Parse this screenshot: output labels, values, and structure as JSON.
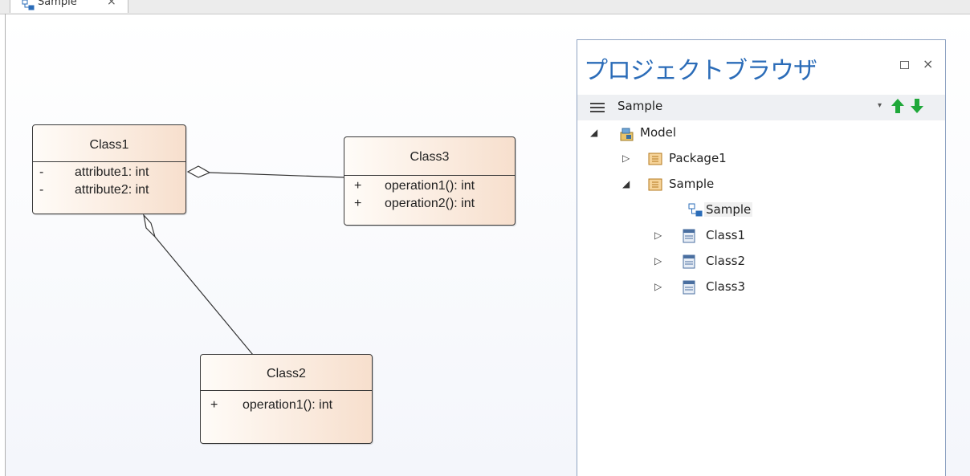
{
  "tab": {
    "label": "Sample",
    "close_glyph": "×",
    "icon": "diagram-icon"
  },
  "diagram": {
    "classes": [
      {
        "name": "Class1",
        "members": [
          {
            "visibility": "-",
            "signature": "attribute1: int"
          },
          {
            "visibility": "-",
            "signature": "attribute2: int"
          }
        ]
      },
      {
        "name": "Class3",
        "members": [
          {
            "visibility": "+",
            "signature": "operation1(): int"
          },
          {
            "visibility": "+",
            "signature": "operation2(): int"
          }
        ]
      },
      {
        "name": "Class2",
        "members": [
          {
            "visibility": "+",
            "signature": "operation1(): int"
          }
        ]
      }
    ],
    "relations": [
      {
        "type": "aggregation",
        "whole": "Class1",
        "part": "Class3"
      },
      {
        "type": "aggregation",
        "whole": "Class1",
        "part": "Class2"
      }
    ]
  },
  "browser": {
    "title": "プロジェクトブラウザ",
    "maximize_icon": "maximize-icon",
    "close_glyph": "×",
    "toolbar": {
      "menu_icon": "hamburger-icon",
      "current": "Sample",
      "dropdown_glyph": "▾",
      "move_up_icon": "arrow-up-icon",
      "move_down_icon": "arrow-down-icon"
    },
    "tree": [
      {
        "label": "Model",
        "icon": "model-root-icon",
        "expander": "◢"
      },
      {
        "label": "Package1",
        "icon": "package-icon",
        "expander": "▷"
      },
      {
        "label": "Sample",
        "icon": "package-icon",
        "expander": "◢"
      },
      {
        "label": "Sample",
        "icon": "diagram-icon",
        "expander": ""
      },
      {
        "label": "Class1",
        "icon": "class-icon",
        "expander": "▷"
      },
      {
        "label": "Class2",
        "icon": "class-icon",
        "expander": "▷"
      },
      {
        "label": "Class3",
        "icon": "class-icon",
        "expander": "▷"
      }
    ]
  },
  "colors": {
    "title_blue": "#2b6cb8",
    "class_fill": "#f7dfcd",
    "arrow_green": "#1fa83a"
  }
}
